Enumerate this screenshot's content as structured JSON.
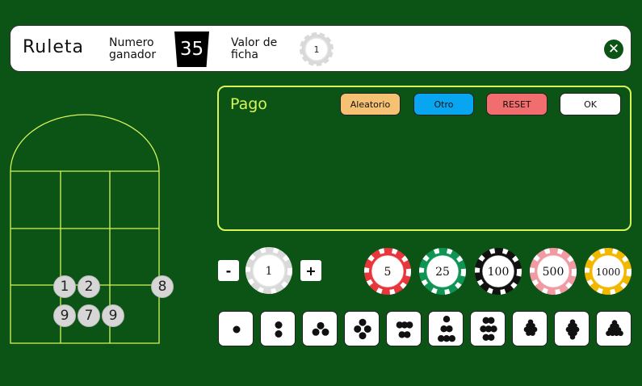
{
  "header": {
    "title": "Ruleta",
    "numero_label": "Numero ganador",
    "winning_number": "35",
    "valor_label": "Valor de ficha",
    "chip_value": "1"
  },
  "board_chips": [
    {
      "label": "1"
    },
    {
      "label": "2"
    },
    {
      "label": "8"
    },
    {
      "label": "9"
    },
    {
      "label": "7"
    },
    {
      "label": "9"
    }
  ],
  "pago": {
    "title": "Pago",
    "buttons": [
      {
        "label": "Aleatorio",
        "color": "#f6c173"
      },
      {
        "label": "Otro",
        "color": "#08a6f0"
      },
      {
        "label": "RESET",
        "color": "#f26d6d"
      },
      {
        "label": "OK",
        "color": "#ffffff"
      }
    ]
  },
  "chip_value_control": {
    "minus": "-",
    "value": "1",
    "plus": "+"
  },
  "chips": [
    {
      "value": "5",
      "color": "#e8363c"
    },
    {
      "value": "25",
      "color": "#0f9454"
    },
    {
      "value": "100",
      "color": "#111111"
    },
    {
      "value": "500",
      "color": "#f29aa3"
    },
    {
      "value": "1000",
      "color": "#f2b800"
    }
  ],
  "dice": [
    1,
    2,
    3,
    4,
    5,
    6,
    7,
    8,
    9,
    10
  ],
  "colors": {
    "felt": "#0b5416",
    "accent": "#d6f55a"
  }
}
